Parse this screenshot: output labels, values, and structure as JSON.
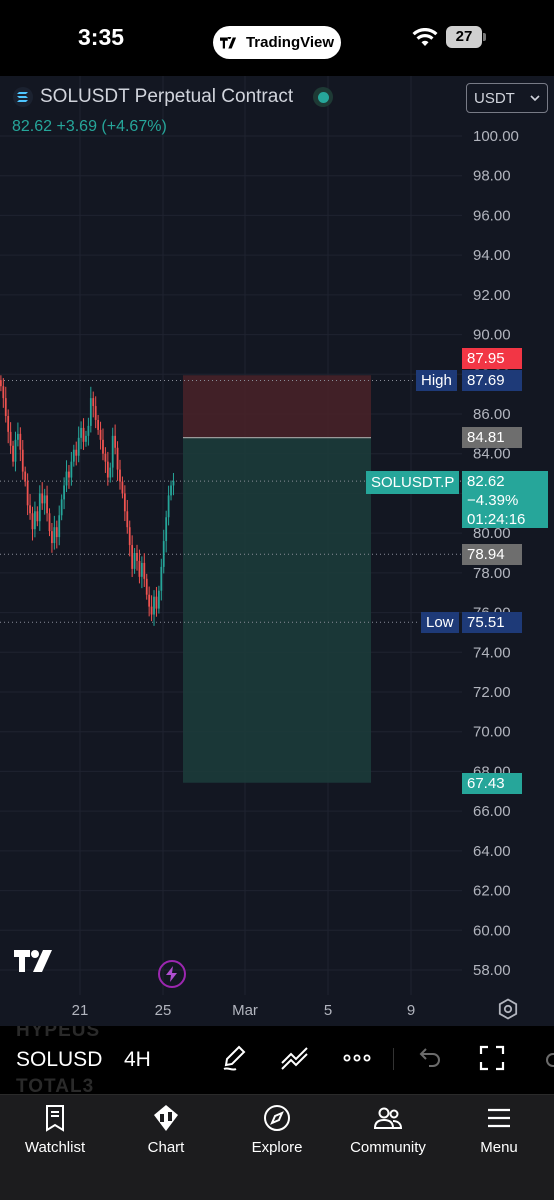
{
  "status_bar": {
    "time": "3:35",
    "app_pill": "TradingView",
    "battery": "27"
  },
  "header": {
    "symbol_title": "SOLUSDT Perpetual Contract",
    "quote_line": "82.62  +3.69 (+4.67%)",
    "currency_select": "USDT"
  },
  "price_axis": {
    "labels": [
      "100.00",
      "98.00",
      "96.00",
      "94.00",
      "92.00",
      "90.00",
      "88.00",
      "86.00",
      "84.00",
      "82.00",
      "80.00",
      "78.00",
      "76.00",
      "74.00",
      "72.00",
      "70.00",
      "68.00",
      "66.00",
      "64.00",
      "62.00",
      "60.00",
      "58.00"
    ]
  },
  "time_axis": {
    "labels": [
      "21",
      "25",
      "Mar",
      "5",
      "9"
    ]
  },
  "tags": {
    "stop_price": "87.95",
    "high_label": "High",
    "high_value": "87.69",
    "entry_price": "84.81",
    "symbol_tag": "SOLUSDT.P",
    "last_price": "82.62",
    "last_change": "−4.39%",
    "countdown": "01:24:16",
    "prev_close": "78.94",
    "low_label": "Low",
    "low_value": "75.51",
    "target_price": "67.43"
  },
  "toolbar": {
    "ghost_top": "HYPEUS",
    "symbol_short": "SOLUSD",
    "interval": "4H",
    "ghost_bottom": "TOTAL3"
  },
  "tabs": [
    {
      "label": "Watchlist",
      "icon": "bookmark-icon"
    },
    {
      "label": "Chart",
      "icon": "candles-icon"
    },
    {
      "label": "Explore",
      "icon": "compass-icon"
    },
    {
      "label": "Community",
      "icon": "people-icon"
    },
    {
      "label": "Menu",
      "icon": "hamburger-icon"
    }
  ],
  "colors": {
    "background": "#131722",
    "up": "#26a69a",
    "down": "#ef5350",
    "stop_zone": "#4a2228",
    "target_zone": "#1c3b3a",
    "high_low_tag": "#1e3a78"
  },
  "chart_data": {
    "type": "candlestick",
    "y_range": [
      56.6,
      101.2
    ],
    "x_labels": [
      "21",
      "25",
      "Mar",
      "5",
      "9"
    ],
    "high": 87.69,
    "low": 75.51,
    "last": 82.62,
    "position": {
      "stop": 87.95,
      "entry": 84.81,
      "target": 67.43
    },
    "closes": [
      87.4,
      86.8,
      85.9,
      85.1,
      84.4,
      83.6,
      84.7,
      85.0,
      84.2,
      83.1,
      82.6,
      81.4,
      81.0,
      80.2,
      81.1,
      80.6,
      82.0,
      81.5,
      81.9,
      81.0,
      80.1,
      79.5,
      80.3,
      79.8,
      80.9,
      81.7,
      82.4,
      83.1,
      82.8,
      83.6,
      84.2,
      83.9,
      84.8,
      85.3,
      84.6,
      84.9,
      85.4,
      86.8,
      86.4,
      85.7,
      85.2,
      84.7,
      84.0,
      83.6,
      82.8,
      83.3,
      84.9,
      84.3,
      83.2,
      82.6,
      82.0,
      81.1,
      80.3,
      79.4,
      78.2,
      79.0,
      78.6,
      77.8,
      78.5,
      77.7,
      76.9,
      76.3,
      75.9,
      76.8,
      76.2,
      77.1,
      78.3,
      79.6,
      80.8,
      81.9,
      82.4,
      82.62
    ]
  }
}
